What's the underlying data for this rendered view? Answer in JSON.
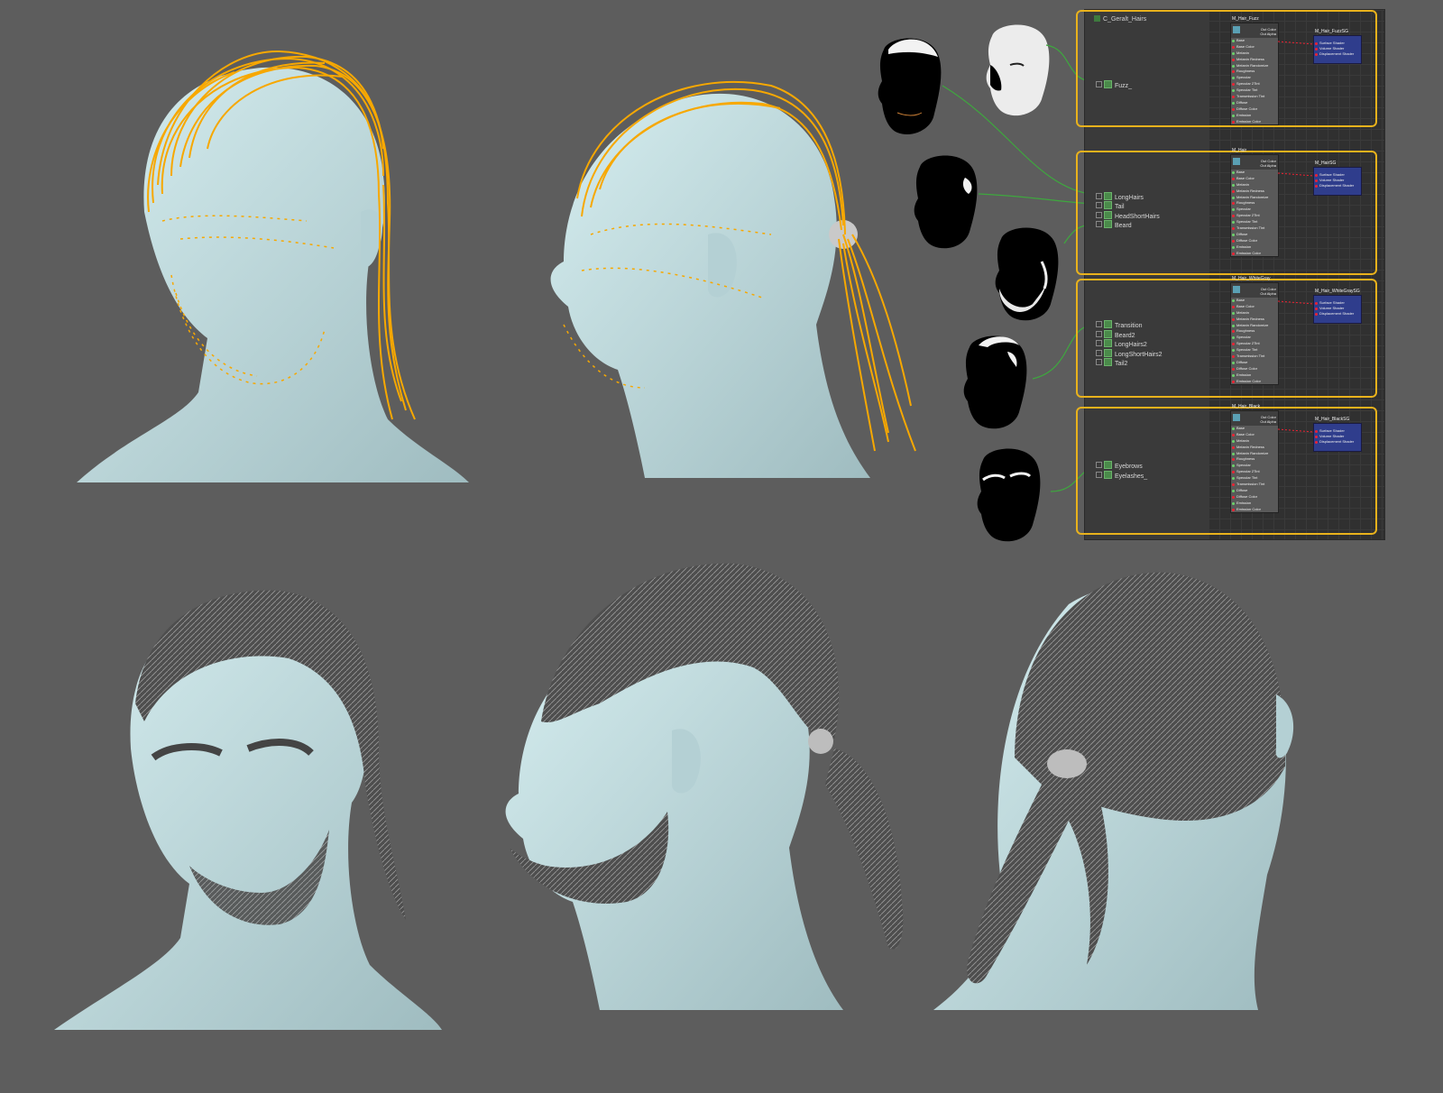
{
  "outliner": {
    "root": "C_Geralt_Hairs",
    "groups": [
      {
        "items": [
          "Fuzz_"
        ]
      },
      {
        "items": [
          "LongHairs",
          "Tail",
          "HeadShortHairs",
          "Beard"
        ]
      },
      {
        "items": [
          "Transition",
          "Beard2",
          "LongHairs2",
          "LongShortHairs2",
          "Tail2"
        ]
      },
      {
        "items": [
          "Eyebrows",
          "Eyelashes_"
        ]
      }
    ]
  },
  "shaders": [
    {
      "material": "M_Hair_Fuzz",
      "shading_group": "M_Hair_FuzzSG"
    },
    {
      "material": "M_Hair",
      "shading_group": "M_HairSG"
    },
    {
      "material": "M_Hair_WhiteGray",
      "shading_group": "M_Hair_WhiteGraySG"
    },
    {
      "material": "M_Hair_Black",
      "shading_group": "M_Hair_BlackSG"
    }
  ],
  "material_ports": [
    "Base",
    "Base Color",
    "Melanin",
    "Melanin Redness",
    "Melanin Randomize",
    "Roughness",
    "Specular",
    "Specular 2Tint",
    "Specular Tint",
    "Transmission Tint",
    "Diffuse",
    "Diffuse Color",
    "Emission",
    "Emission Color"
  ],
  "material_outputs": [
    "Out Color",
    "Out Alpha"
  ],
  "sg_ports": [
    "Surface Shader",
    "Volume Shader",
    "Displacement Shader"
  ],
  "colors": {
    "background": "#5d5d5d",
    "guides": "#f7a800",
    "skin": "#c3dde0",
    "group_border": "#e9b21c",
    "sg_node": "#2f3d8c"
  }
}
